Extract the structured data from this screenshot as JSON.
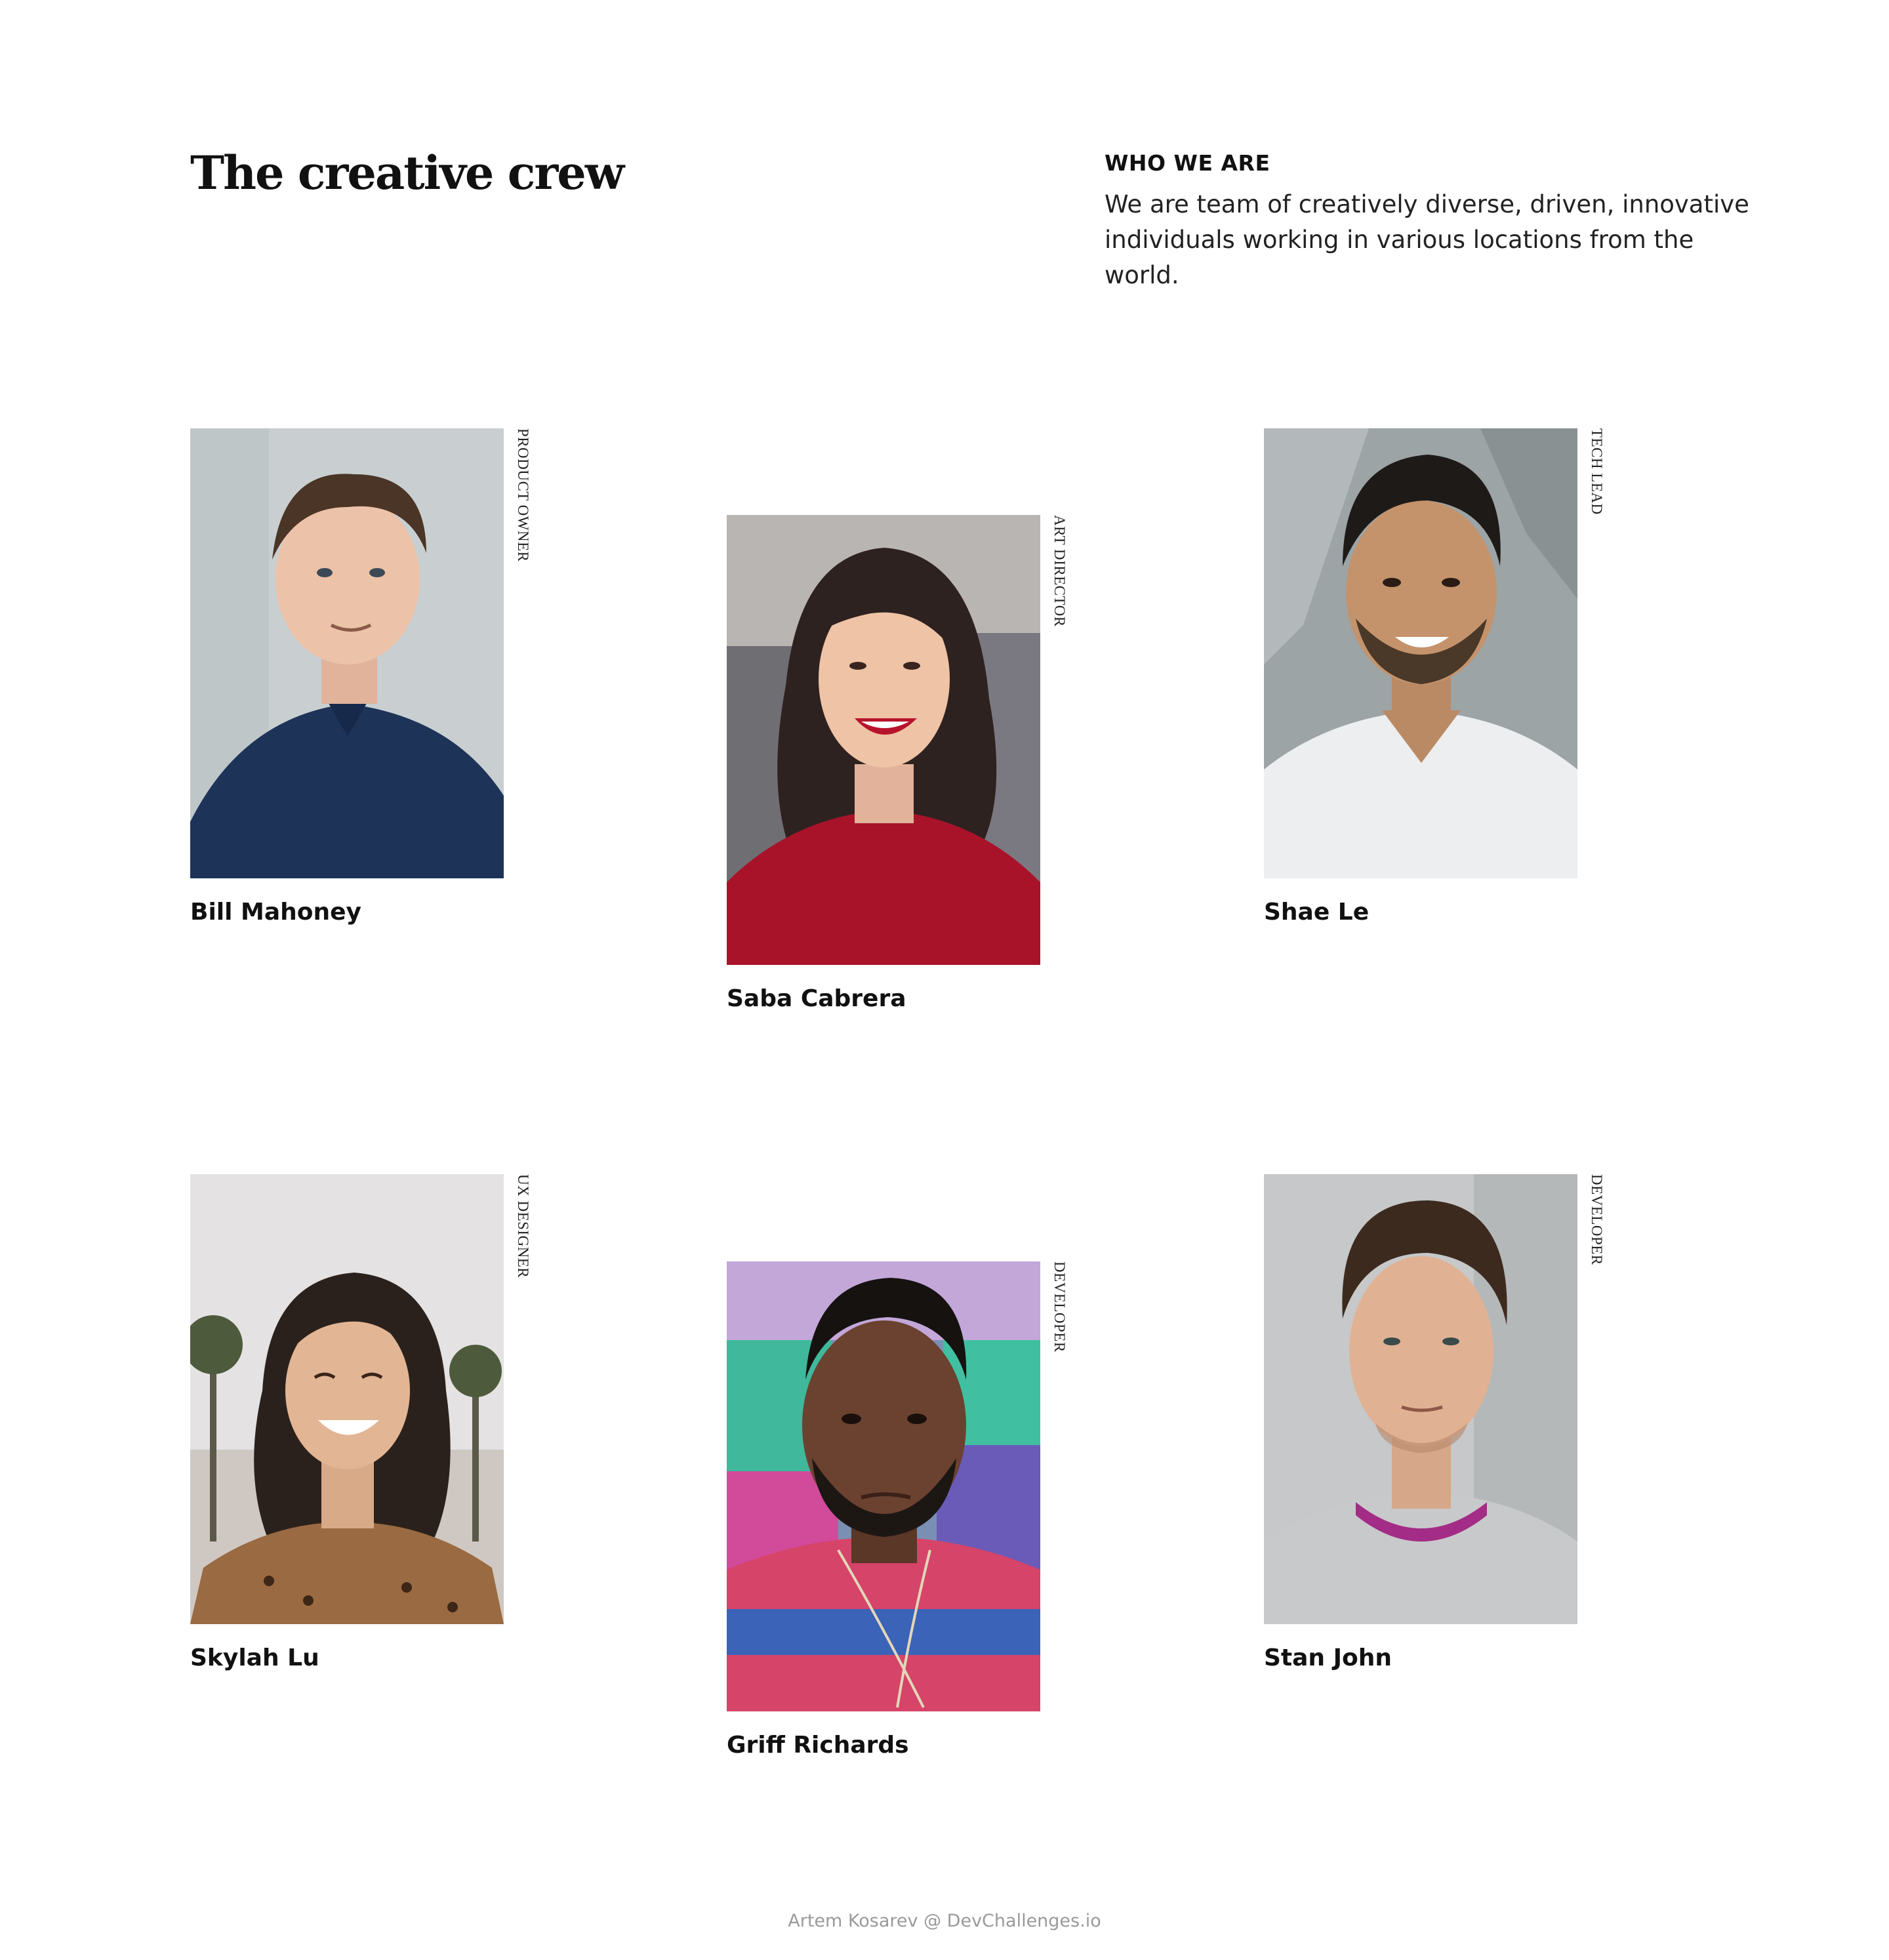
{
  "header": {
    "title": "The creative crew",
    "intro_heading": "WHO WE ARE",
    "intro_text": "We are team of creatively diverse, driven, innovative individuals working in various locations from the world."
  },
  "members": [
    {
      "name": "Bill Mahoney",
      "role": "PRODUCT OWNER"
    },
    {
      "name": "Saba Cabrera",
      "role": "ART DIRECTOR"
    },
    {
      "name": "Shae Le",
      "role": "TECH LEAD"
    },
    {
      "name": "Skylah Lu",
      "role": "UX DESIGNER"
    },
    {
      "name": "Griff Richards",
      "role": "DEVELOPER"
    },
    {
      "name": "Stan John",
      "role": "DEVELOPER"
    }
  ],
  "footer": {
    "credit": "Artem Kosarev @ DevChallenges.io"
  }
}
